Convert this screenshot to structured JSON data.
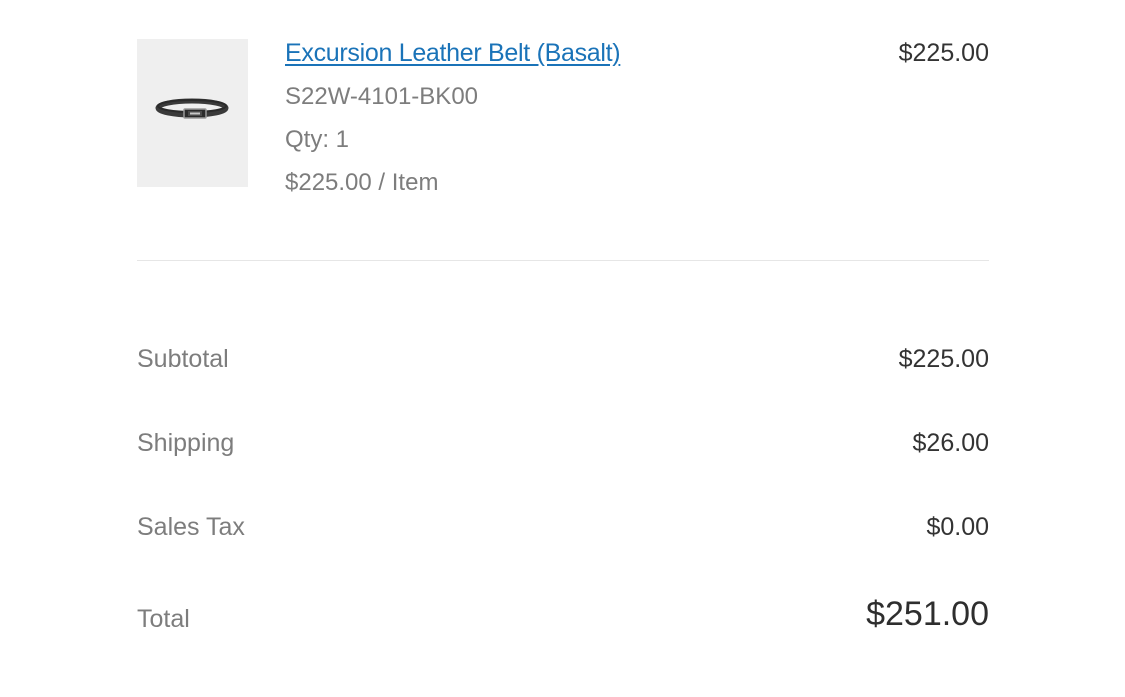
{
  "product": {
    "name": "Excursion Leather Belt (Basalt)",
    "sku": "S22W-4101-BK00",
    "quantity": "Qty: 1",
    "unit_price": "$225.00 / Item",
    "line_total": "$225.00",
    "image_icon": "belt-product-image",
    "link_color": "#1a73b8"
  },
  "summary": {
    "subtotal_label": "Subtotal",
    "subtotal_value": "$225.00",
    "shipping_label": "Shipping",
    "shipping_value": "$26.00",
    "tax_label": "Sales Tax",
    "tax_value": "$0.00",
    "total_label": "Total",
    "total_value": "$251.00"
  }
}
